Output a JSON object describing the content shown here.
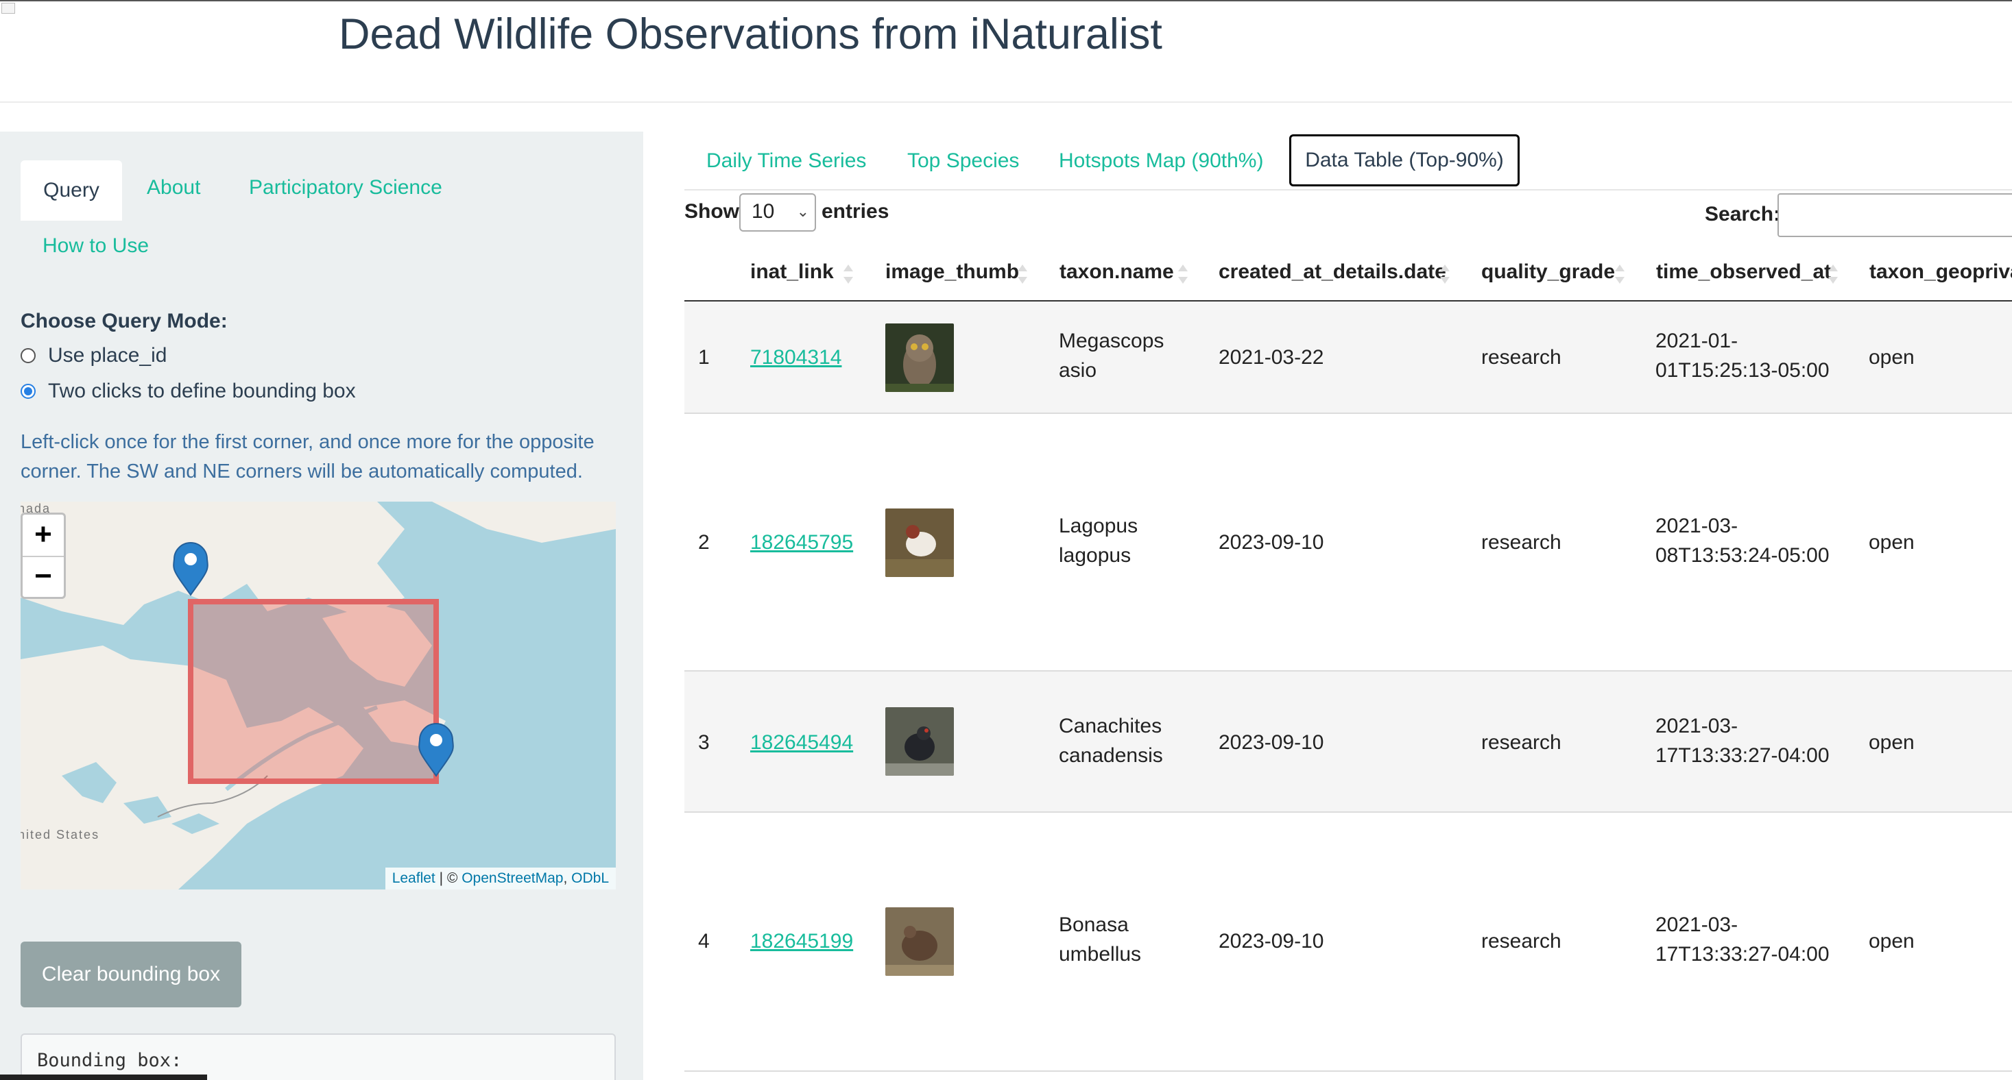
{
  "header": {
    "title": "Dead Wildlife Observations from iNaturalist"
  },
  "sidebar": {
    "tabs": [
      {
        "label": "Query"
      },
      {
        "label": "About"
      },
      {
        "label": "Participatory Science"
      },
      {
        "label": "How to Use"
      }
    ],
    "active_tab": "Query",
    "query_mode_label": "Choose Query Mode:",
    "modes": [
      {
        "label": "Use place_id",
        "checked": false
      },
      {
        "label": "Two clicks to define bounding box",
        "checked": true
      }
    ],
    "help_text": "Left-click once for the first corner, and once more for the opposite corner. The SW and NE corners will be automatically computed.",
    "map": {
      "zoom_in": "+",
      "zoom_out": "−",
      "label_canada": "nada",
      "label_us": "nited States",
      "attribution_leaflet": "Leaflet",
      "attribution_sep": " | © ",
      "attribution_osm": "OpenStreetMap",
      "attribution_comma": ", ",
      "attribution_odbl": "ODbL"
    },
    "clear_button": "Clear bounding box",
    "bbox_output": "Bounding box:"
  },
  "main": {
    "tabs": [
      {
        "label": "Daily Time Series"
      },
      {
        "label": "Top Species"
      },
      {
        "label": "Hotspots Map (90th%)"
      },
      {
        "label": "Data Table (Top-90%)"
      }
    ],
    "active_tab": "Data Table (Top-90%)",
    "length": {
      "show": "Show",
      "value": "10",
      "entries": "entries"
    },
    "search_label": "Search:",
    "table": {
      "columns": [
        "inat_link",
        "image_thumb",
        "taxon.name",
        "created_at_details.date",
        "quality_grade",
        "time_observed_at",
        "taxon_geoprivacy"
      ],
      "rows": [
        {
          "index": "1",
          "inat_link": "71804314",
          "image_thumb": "owl",
          "taxon_1": "Megascops",
          "taxon_2": "asio",
          "date": "2021-03-22",
          "quality": "research",
          "time_1": "2021-01-",
          "time_2": "01T15:25:13-05:00",
          "geo": "open"
        },
        {
          "index": "2",
          "inat_link": "182645795",
          "image_thumb": "ptarmigan",
          "taxon_1": "Lagopus",
          "taxon_2": "lagopus",
          "date": "2023-09-10",
          "quality": "research",
          "time_1": "2021-03-",
          "time_2": "08T13:53:24-05:00",
          "geo": "open"
        },
        {
          "index": "3",
          "inat_link": "182645494",
          "image_thumb": "grouse",
          "taxon_1": "Canachites",
          "taxon_2": "canadensis",
          "date": "2023-09-10",
          "quality": "research",
          "time_1": "2021-03-",
          "time_2": "17T13:33:27-04:00",
          "geo": "open"
        },
        {
          "index": "4",
          "inat_link": "182645199",
          "image_thumb": "ruffed-grouse",
          "taxon_1": "Bonasa",
          "taxon_2": "umbellus",
          "date": "2023-09-10",
          "quality": "research",
          "time_1": "2021-03-",
          "time_2": "17T13:33:27-04:00",
          "geo": "open"
        }
      ]
    }
  },
  "colors": {
    "accent": "#18bc9c",
    "primary": "#2c3e50",
    "sidebar_bg": "#ecf0f1",
    "button_gray": "#95a5a6",
    "bbox_red": "#e74c3c",
    "marker_blue": "#2a81cb"
  }
}
